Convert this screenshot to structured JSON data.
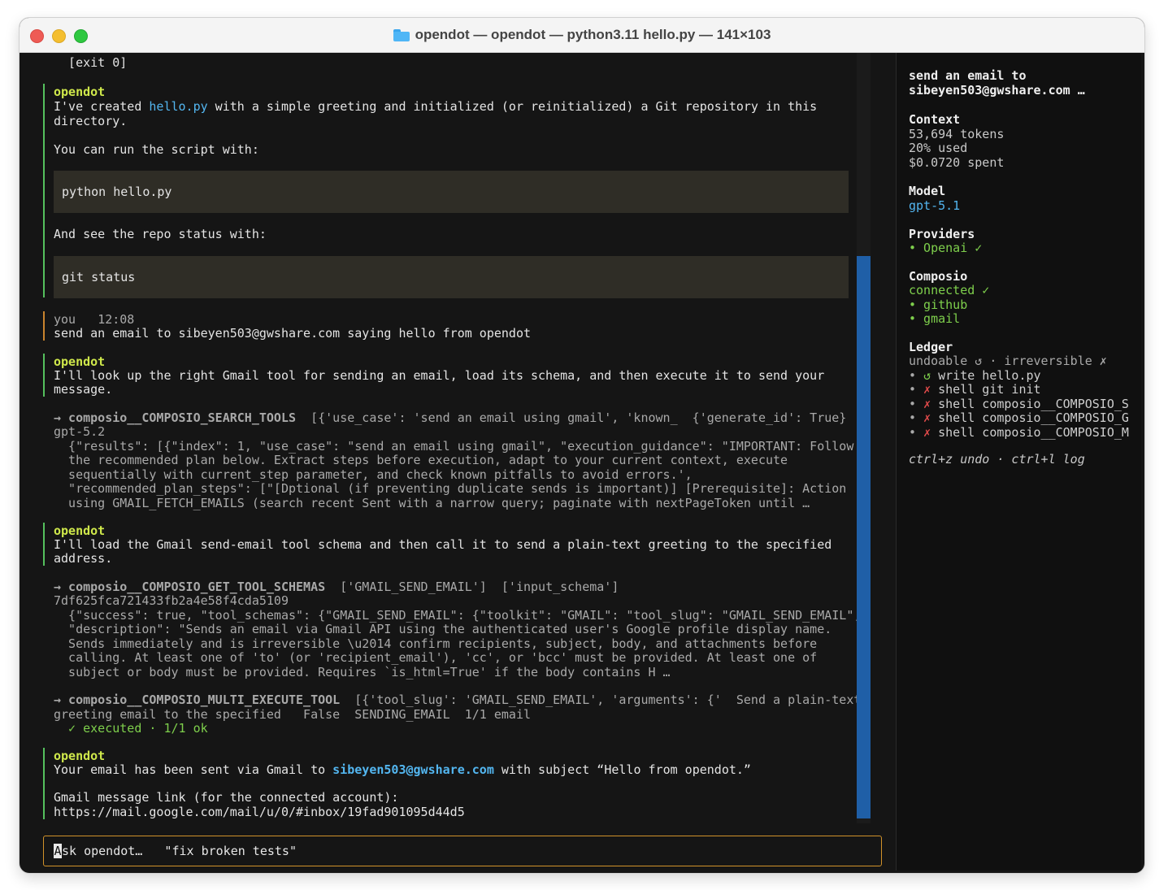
{
  "window": {
    "title": "opendot — opendot — python3.11 hello.py — 141×103"
  },
  "transcript": {
    "exit": "  [exit 0]",
    "msg1": {
      "author": "opendot",
      "l1_pre": "I've created ",
      "l1_file": "hello.py",
      "l1_post": " with a simple greeting and initialized (or reinitialized) a Git repository in this",
      "l2": "directory.",
      "l3": "You can run the script with:",
      "code1": "python hello.py",
      "l4": "And see the repo status with:",
      "code2": "git status"
    },
    "user": {
      "author": "you",
      "time": "12:08",
      "text": "send an email to sibeyen503@gwshare.com saying hello from opendot"
    },
    "msg2": {
      "author": "opendot",
      "l1": "I'll look up the right Gmail tool for sending an email, load its schema, and then execute it to send your",
      "l2": "message."
    },
    "tool1": {
      "name": "→ composio__COMPOSIO_SEARCH_TOOLS",
      "args": "  [{'use_case': 'send an email using gmail', 'known_  {'generate_id': True}",
      "sub": "gpt-5.2",
      "out": [
        "  {\"results\": [{\"index\": 1, \"use_case\": \"send an email using gmail\", \"execution_guidance\": \"IMPORTANT: Follow",
        "  the recommended plan below. Extract steps before execution, adapt to your current context, execute",
        "  sequentially with current_step parameter, and check known pitfalls to avoid errors.',",
        "  \"recommended_plan_steps\": [\"[Dptional (if preventing duplicate sends is important)] [Prerequisite]: Action",
        "  using GMAIL_FETCH_EMAILS (search recent Sent with a narrow query; paginate with nextPageToken until …"
      ]
    },
    "msg3": {
      "author": "opendot",
      "l1": "I'll load the Gmail send-email tool schema and then call it to send a plain-text greeting to the specified",
      "l2": "address."
    },
    "tool2": {
      "name": "→ composio__COMPOSIO_GET_TOOL_SCHEMAS",
      "args": "  ['GMAIL_SEND_EMAIL']  ['input_schema']",
      "sub": "7df625fca721433fb2a4e58f4cda5109",
      "out": [
        "  {\"success\": true, \"tool_schemas\": {\"GMAIL_SEND_EMAIL\": {\"toolkit\": \"GMAIL\": \"tool_slug\": \"GMAIL_SEND_EMAIL\",",
        "  \"description\": \"Sends an email via Gmail API using the authenticated user's Google profile display name.",
        "  Sends immediately and is irreversible \\u2014 confirm recipients, subject, body, and attachments before",
        "  calling. At least one of 'to' (or 'recipient_email'), 'cc', or 'bcc' must be provided. At least one of",
        "  subject or body must be provided. Requires `is_html=True' if the body contains H …"
      ]
    },
    "tool3": {
      "name": "→ composio__COMPOSIO_MULTI_EXECUTE_TOOL",
      "args": "  [{'tool_slug': 'GMAIL_SEND_EMAIL', 'arguments': {'  Send a plain-text",
      "sub": "greeting email to the specified   False  SENDING_EMAIL  1/1 email",
      "status": "  ✓ executed · 1/1 ok"
    },
    "msg4": {
      "author": "opendot",
      "l1_pre": "Your email has been sent via Gmail to ",
      "l1_email": "sibeyen503@gwshare.com",
      "l1_post": " with subject “Hello from opendot.”",
      "l2": "Gmail message link (for the connected account):",
      "l3": "https://mail.google.com/mail/u/0/#inbox/19fad901095d44d5"
    }
  },
  "input": {
    "cursor_char": "A",
    "placeholder": "sk opendot…   \"fix broken tests\""
  },
  "sidebar": {
    "session_title_1": "send an email to",
    "session_title_2": "sibeyen503@gwshare.com …",
    "context": {
      "heading": "Context",
      "tokens": "53,694 tokens",
      "used": "20% used",
      "spent": "$0.0720 spent"
    },
    "model": {
      "heading": "Model",
      "value": "gpt-5.1"
    },
    "providers": {
      "heading": "Providers",
      "item": "• Openai ✓"
    },
    "composio": {
      "heading": "Composio",
      "status": "connected ✓",
      "items": [
        "• github",
        "• gmail"
      ]
    },
    "ledger": {
      "heading": "Ledger",
      "legend": "undoable ↺ · irreversible ✗",
      "entries": [
        {
          "bullet": "• ",
          "mark": "↺",
          "text": " write hello.py",
          "undoable": true
        },
        {
          "bullet": "• ",
          "mark": "✗",
          "text": " shell git init",
          "undoable": false
        },
        {
          "bullet": "• ",
          "mark": "✗",
          "text": " shell composio__COMPOSIO_S",
          "undoable": false
        },
        {
          "bullet": "• ",
          "mark": "✗",
          "text": " shell composio__COMPOSIO_G",
          "undoable": false
        },
        {
          "bullet": "• ",
          "mark": "✗",
          "text": " shell composio__COMPOSIO_M",
          "undoable": false
        }
      ]
    },
    "shortcuts": "ctrl+z undo · ctrl+l log"
  },
  "colors": {
    "background": "#151515",
    "agent_name": "#cfe84b",
    "link": "#53b6f0",
    "success": "#7ecf4c",
    "error": "#e24b4b",
    "input_border": "#d1922a",
    "scroll_thumb": "#1f5fa7"
  }
}
